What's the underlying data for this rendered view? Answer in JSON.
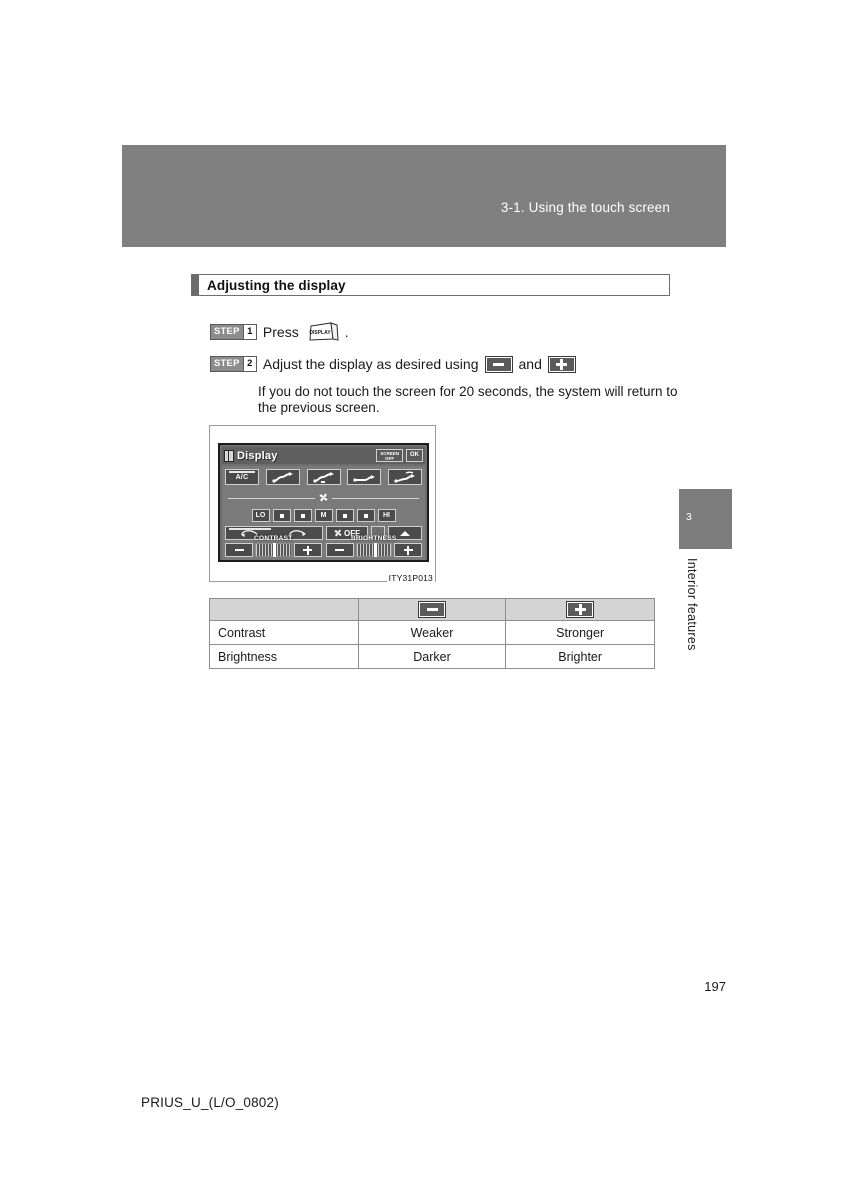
{
  "page": {
    "header_title": "3-1. Using the touch screen",
    "section_title": "Adjusting the display",
    "page_number": "197",
    "footer_code": "PRIUS_U_(L/O_0802)"
  },
  "chapter_tab": {
    "number": "3",
    "label": "Interior features"
  },
  "steps": [
    {
      "badge_word": "STEP",
      "badge_num": "1",
      "text_before": "Press",
      "button_icon": "display-button-icon",
      "button_label": "DISPLAY",
      "text_after": "."
    },
    {
      "badge_word": "STEP",
      "badge_num": "2",
      "text_before": "Adjust the display as desired using",
      "minus_icon": "minus-key-icon",
      "conjunction": "and",
      "plus_icon": "plus-key-icon",
      "note": "If you do not touch the screen for 20 seconds, the system will return to the previous screen."
    }
  ],
  "figure": {
    "caption": "ITY31P013",
    "screen": {
      "title": "Display",
      "title_icon": "book-icon",
      "buttons": [
        {
          "line1": "SCREEN",
          "line2": "OFF",
          "name": "screen-off-button"
        },
        {
          "line1": "OK",
          "line2": "",
          "name": "ok-button"
        }
      ],
      "mode_row": [
        {
          "label": "A/C",
          "name": "ac-button"
        },
        {
          "label": "",
          "name": "airflow-face-button"
        },
        {
          "label": "",
          "name": "airflow-face-feet-button"
        },
        {
          "label": "",
          "name": "airflow-feet-button"
        },
        {
          "label": "",
          "name": "airflow-feet-defog-button"
        }
      ],
      "fan_icon": "fan-icon",
      "fan_row": [
        "LO",
        "▪",
        "▪",
        "M",
        "▪",
        "▪",
        "HI"
      ],
      "bottom_row": {
        "air_recirc_name": "air-recirculation-button",
        "off_label": "OFF",
        "off_icon": "fan-icon",
        "defog_name": "rear-defogger-button",
        "up_name": "scroll-up-button"
      },
      "sliders": [
        {
          "label": "CONTRAST",
          "minus": "−",
          "plus": "+"
        },
        {
          "label": "BRIGHTNESS",
          "minus": "−",
          "plus": "+"
        }
      ]
    }
  },
  "table": {
    "headers": [
      "",
      "minus-key-icon",
      "plus-key-icon"
    ],
    "rows": [
      {
        "setting": "Contrast",
        "minus": "Weaker",
        "plus": "Stronger"
      },
      {
        "setting": "Brightness",
        "minus": "Darker",
        "plus": "Brighter"
      }
    ]
  },
  "colors": {
    "header_band": "#808080",
    "chapter_tab": "#7c7c7c",
    "table_header": "#d4d4d4",
    "screen_bg": "#6e6e6e"
  }
}
